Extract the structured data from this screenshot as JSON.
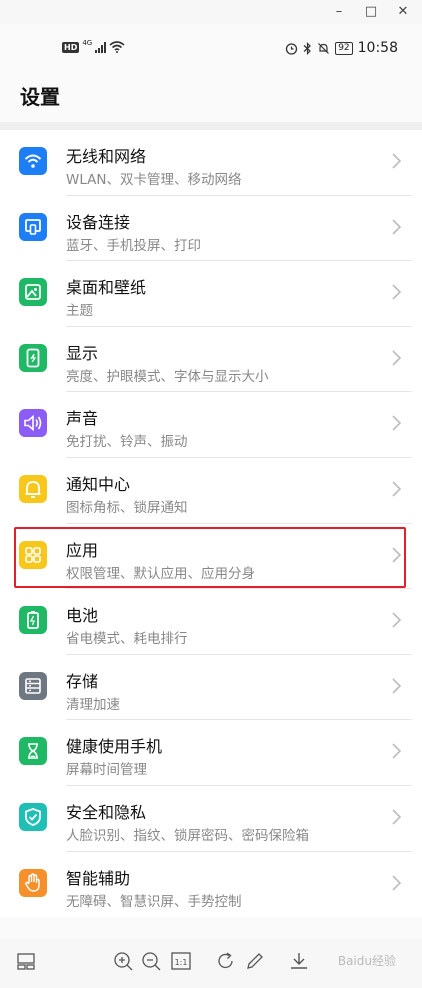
{
  "window": {
    "minimize_glyph": "–",
    "maximize_glyph": "□",
    "close_glyph": "✕"
  },
  "status_bar": {
    "network": "HD",
    "signal_tag": "4G",
    "battery": "92",
    "time": "10:58"
  },
  "page_title": "设置",
  "items": [
    {
      "title": "无线和网络",
      "subtitle": "WLAN、双卡管理、移动网络",
      "icon": "wifi-icon",
      "color": "#1d7ef5"
    },
    {
      "title": "设备连接",
      "subtitle": "蓝牙、手机投屏、打印",
      "icon": "device-connection-icon",
      "color": "#1d7ef5"
    },
    {
      "title": "桌面和壁纸",
      "subtitle": "主题",
      "icon": "wallpaper-icon",
      "color": "#1fb965"
    },
    {
      "title": "显示",
      "subtitle": "亮度、护眼模式、字体与显示大小",
      "icon": "display-icon",
      "color": "#1fb965"
    },
    {
      "title": "声音",
      "subtitle": "免打扰、铃声、振动",
      "icon": "sound-icon",
      "color": "#8b5cf6"
    },
    {
      "title": "通知中心",
      "subtitle": "图标角标、锁屏通知",
      "icon": "notification-icon",
      "color": "#f8c71c"
    },
    {
      "title": "应用",
      "subtitle": "权限管理、默认应用、应用分身",
      "icon": "apps-icon",
      "color": "#f8c71c"
    },
    {
      "title": "电池",
      "subtitle": "省电模式、耗电排行",
      "icon": "battery-icon",
      "color": "#1fb965"
    },
    {
      "title": "存储",
      "subtitle": "清理加速",
      "icon": "storage-icon",
      "color": "#6f7782"
    },
    {
      "title": "健康使用手机",
      "subtitle": "屏幕时间管理",
      "icon": "hourglass-icon",
      "color": "#1fb965"
    },
    {
      "title": "安全和隐私",
      "subtitle": "人脸识别、指纹、锁屏密码、密码保险箱",
      "icon": "shield-icon",
      "color": "#1fbfb5"
    },
    {
      "title": "智能辅助",
      "subtitle": "无障碍、智慧识屏、手势控制",
      "icon": "hand-icon",
      "color": "#f5902b"
    }
  ],
  "viewer_toolbar": {
    "icons": [
      "thumbnail-icon",
      "zoom-in-icon",
      "zoom-out-icon",
      "actual-size-icon",
      "rotate-icon",
      "edit-icon",
      "download-icon"
    ],
    "actual_size_label": "1:1"
  },
  "watermark": "Baidu经验"
}
